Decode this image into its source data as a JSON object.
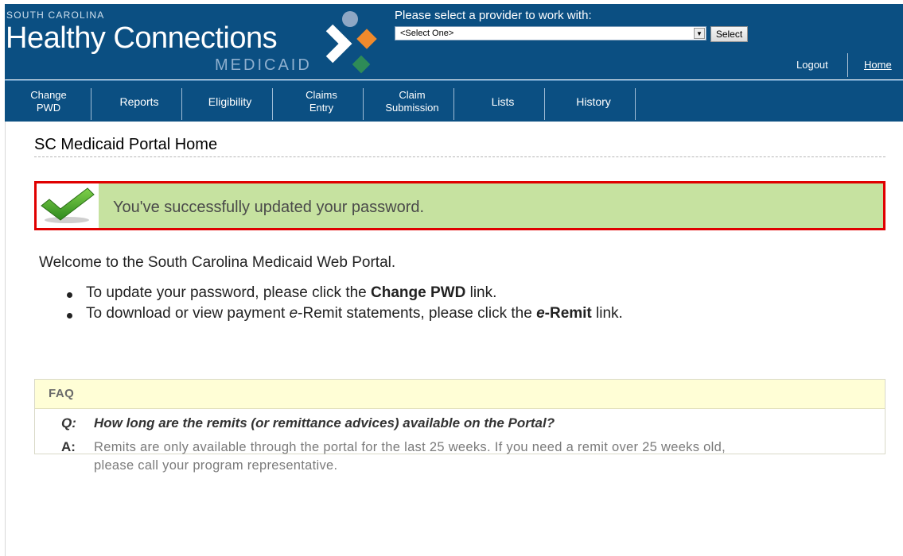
{
  "header": {
    "brand_top": "SOUTH CAROLINA",
    "brand_main": "Healthy Connections",
    "brand_sub": "MEDICAID",
    "provider_label": "Please select a provider to work with:",
    "provider_selected": "<Select One>",
    "select_button": "Select",
    "logout": "Logout",
    "home": "Home",
    "logo_colors": [
      "#8fa7c4",
      "#f08a2c",
      "#2e8b57",
      "#ffffff"
    ]
  },
  "nav": {
    "items": [
      {
        "label": "Change PWD",
        "line1": "Change",
        "line2": "PWD"
      },
      {
        "label": "Reports"
      },
      {
        "label": "Eligibility"
      },
      {
        "label": "Claims Entry",
        "line1": "Claims",
        "line2": "Entry"
      },
      {
        "label": "Claim Submission",
        "line1": "Claim",
        "line2": "Submission"
      },
      {
        "label": "Lists"
      },
      {
        "label": "History"
      }
    ]
  },
  "main": {
    "page_title": "SC Medicaid Portal Home",
    "alert": {
      "icon": "checkmark-icon",
      "message": "You've successfully updated your password."
    },
    "welcome": "Welcome to the South Carolina Medicaid Web Portal.",
    "bullets": [
      {
        "pre": "To update your password, please click the ",
        "bold": "Change PWD",
        "post": " link."
      },
      {
        "pre": "To download or view payment ",
        "italic": "e",
        "mid": "-Remit statements, please click the ",
        "bolditalic": "e",
        "bold": "-Remit",
        "post": " link."
      }
    ],
    "faq": {
      "heading": "FAQ",
      "q_label": "Q:",
      "question": "How long are the remits (or remittance advices) available on the Portal?",
      "a_label": "A:",
      "answer": "Remits are only available through the portal for the last 25 weeks. If you need a remit over 25 weeks old, please call your program representative."
    }
  },
  "colors": {
    "header_blue": "#0b4f82",
    "alert_border": "#e00000",
    "alert_bg": "#c6e2a0",
    "faq_bg": "#fffed6"
  }
}
